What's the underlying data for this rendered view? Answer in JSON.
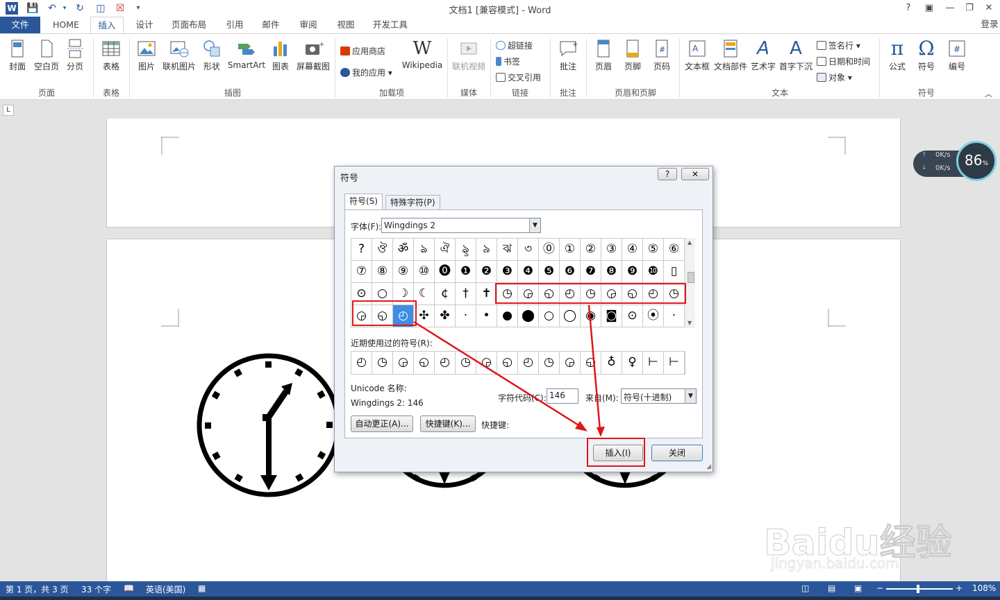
{
  "window": {
    "title": "文档1 [兼容模式] - Word",
    "help": "?",
    "login": "登录"
  },
  "tabs": [
    "文件",
    "HOME",
    "插入",
    "设计",
    "页面布局",
    "引用",
    "邮件",
    "审阅",
    "视图",
    "开发工具"
  ],
  "ribbon": {
    "groups": [
      "页面",
      "表格",
      "插图",
      "加载项",
      "媒体",
      "链接",
      "批注",
      "页眉和页脚",
      "文本",
      "符号"
    ],
    "page_items": [
      "封面",
      "空白页",
      "分页"
    ],
    "table_items": [
      "表格"
    ],
    "illustration_items": [
      "图片",
      "联机图片",
      "形状",
      "SmartArt",
      "图表",
      "屏幕截图"
    ],
    "addin_items": [
      "应用商店",
      "我的应用",
      "Wikipedia"
    ],
    "media_items": [
      "联机视频"
    ],
    "link_items": [
      "超链接",
      "书签",
      "交叉引用"
    ],
    "comment_items": [
      "批注"
    ],
    "header_footer_items": [
      "页眉",
      "页脚",
      "页码"
    ],
    "text_items": [
      "文本框",
      "文档部件",
      "艺术字",
      "首字下沉"
    ],
    "text_small_items": [
      "签名行",
      "日期和时间",
      "对象"
    ],
    "symbol_items": [
      "公式",
      "符号",
      "编号"
    ]
  },
  "statusbar": {
    "page": "第 1 页，共 3 页",
    "words": "33 个字",
    "language": "英语(美国)",
    "zoom": "108%"
  },
  "speed_widget": {
    "up": "0K/s",
    "down": "0K/s",
    "percent": "86",
    "percent_sign": "%"
  },
  "dialog": {
    "title": "符号",
    "help_btn": "?",
    "close_btn": "✕",
    "tab_symbols": "符号(S)",
    "tab_special": "特殊字符(P)",
    "font_label": "字体(F):",
    "font_value": "Wingdings 2",
    "grid": [
      [
        "?",
        "ঔ",
        "ॐ",
        "ঌ",
        "ঐ",
        "ৡ",
        "৯",
        "ঝ",
        "৩",
        "⓪",
        "①",
        "②",
        "③",
        "④",
        "⑤",
        "⑥"
      ],
      [
        "⑦",
        "⑧",
        "⑨",
        "⑩",
        "⓿",
        "❶",
        "❷",
        "❸",
        "❹",
        "❺",
        "❻",
        "❼",
        "❽",
        "❾",
        "❿",
        "▯"
      ],
      [
        "⊙",
        "○",
        "☽",
        "☾",
        "¢",
        "†",
        "✝",
        "◷",
        "◶",
        "◵",
        "◴",
        "◷",
        "◶",
        "◵",
        "◴",
        "◷"
      ],
      [
        "◶",
        "◵",
        "◴",
        "✣",
        "✤",
        "·",
        "•",
        "●",
        "⬤",
        "○",
        "◯",
        "◉",
        "◙",
        "⊙",
        "⦿",
        "·"
      ]
    ],
    "recent_label": "近期使用过的符号(R):",
    "recent": [
      "◴",
      "◷",
      "◶",
      "◵",
      "◴",
      "◷",
      "◶",
      "◵",
      "◴",
      "◷",
      "◶",
      "◵",
      "♁",
      "♀",
      "⊢",
      "⊢"
    ],
    "unicode_name_label": "Unicode 名称:",
    "unicode_value": "Wingdings 2: 146",
    "char_code_label": "字符代码(C):",
    "char_code_value": "146",
    "from_label": "来自(M):",
    "from_value": "符号(十进制)",
    "autocorrect_btn": "自动更正(A)...",
    "shortcut_btn": "快捷键(K)...",
    "shortcut_label": "快捷键:",
    "insert_btn": "插入(I)",
    "close_btn_label": "关闭"
  },
  "watermark": {
    "brand": "Baidu经验",
    "url": "jingyan.baidu.com"
  },
  "colors": {
    "accent": "#2b579a",
    "highlight": "#e0161b",
    "selected": "#3d8ee3"
  }
}
